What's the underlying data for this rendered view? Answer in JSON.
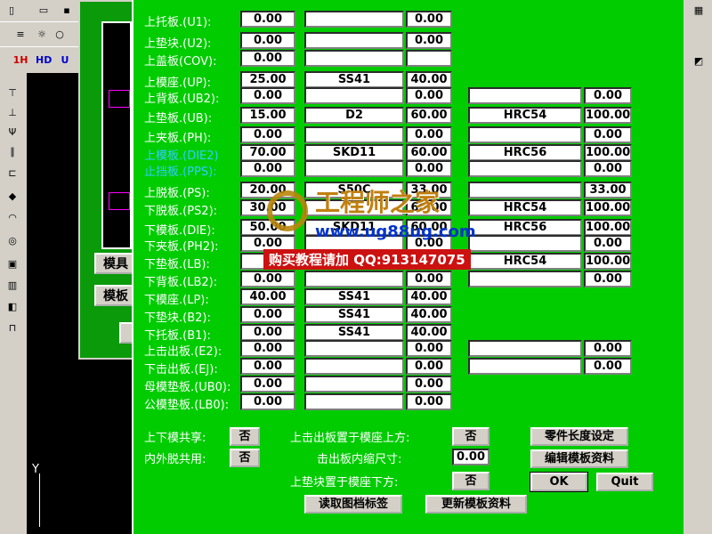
{
  "toolbar": {
    "row3_items": [
      "1H",
      "HD",
      "U"
    ]
  },
  "background_window": {
    "button_1": "模具",
    "button_2": "模板"
  },
  "rows": [
    {
      "label": "上托板.(U1):",
      "cyan": false,
      "a": "0.00",
      "b": "",
      "c": "0.00"
    },
    {
      "label": "上垫块.(U2):",
      "cyan": false,
      "a": "0.00",
      "b": "",
      "c": "0.00"
    },
    {
      "label": "上盖板(COV):",
      "cyan": false,
      "a": "0.00",
      "b": "",
      "c": ""
    },
    {
      "label": "上模座.(UP):",
      "cyan": false,
      "a": "25.00",
      "b": "SS41",
      "c": "40.00"
    },
    {
      "label": "上背板.(UB2):",
      "cyan": false,
      "a": "0.00",
      "b": "",
      "c": "0.00",
      "d": "",
      "e": "0.00"
    },
    {
      "label": "上垫板.(UB):",
      "cyan": false,
      "a": "15.00",
      "b": "D2",
      "c": "60.00",
      "d": "HRC54",
      "e": "100.00"
    },
    {
      "label": "上夹板.(PH):",
      "cyan": false,
      "a": "0.00",
      "b": "",
      "c": "0.00",
      "d": "",
      "e": "0.00"
    },
    {
      "label": "上模板.(DIE2)",
      "cyan": true,
      "a": "70.00",
      "b": "SKD11",
      "c": "60.00",
      "d": "HRC56",
      "e": "100.00"
    },
    {
      "label": "止挡板.(PPS):",
      "cyan": true,
      "a": "0.00",
      "b": "",
      "c": "0.00",
      "d": "",
      "e": "0.00"
    },
    {
      "label": "上脱板.(PS):",
      "cyan": false,
      "a": "20.00",
      "b": "S50C",
      "c": "33.00",
      "d": "",
      "e": "33.00"
    },
    {
      "label": "下脱板.(PS2):",
      "cyan": false,
      "a": "30.00",
      "b": "",
      "c": "60.00",
      "d": "HRC54",
      "e": "100.00"
    },
    {
      "label": "下模板.(DIE):",
      "cyan": false,
      "a": "50.00",
      "b": "SKD11",
      "c": "60.00",
      "d": "HRC56",
      "e": "100.00"
    },
    {
      "label": "下夹板.(PH2):",
      "cyan": false,
      "a": "0.00",
      "b": "",
      "c": "0.00",
      "d": "",
      "e": "0.00"
    },
    {
      "label": "下垫板.(LB):",
      "cyan": false,
      "a": "",
      "b": "",
      "c": "",
      "d": "HRC54",
      "e": "100.00"
    },
    {
      "label": "下背板.(LB2):",
      "cyan": false,
      "a": "0.00",
      "b": "",
      "c": "0.00",
      "d": "",
      "e": "0.00"
    },
    {
      "label": "下模座.(LP):",
      "cyan": false,
      "a": "40.00",
      "b": "SS41",
      "c": "40.00"
    },
    {
      "label": "下垫块.(B2):",
      "cyan": false,
      "a": "0.00",
      "b": "SS41",
      "c": "40.00"
    },
    {
      "label": "下托板.(B1):",
      "cyan": false,
      "a": "0.00",
      "b": "SS41",
      "c": "40.00"
    },
    {
      "label": "上击出板.(E2):",
      "cyan": false,
      "a": "0.00",
      "b": "",
      "c": "0.00",
      "d": "",
      "e": "0.00"
    },
    {
      "label": "下击出板.(EJ):",
      "cyan": false,
      "a": "0.00",
      "b": "",
      "c": "0.00",
      "d": "",
      "e": "0.00"
    },
    {
      "label": "母模垫板.(UB0):",
      "cyan": false,
      "a": "0.00",
      "b": "",
      "c": "0.00"
    },
    {
      "label": "公模垫板.(LB0):",
      "cyan": false,
      "a": "0.00",
      "b": "",
      "c": "0.00"
    }
  ],
  "bottom": {
    "shared_label": "上下模共享:",
    "shared_value": "否",
    "inner_label": "内外脱共用:",
    "inner_value": "否",
    "upper_eject_label": "上击出板置于模座上方:",
    "upper_eject_value": "否",
    "eject_shrink_label": "击出板内缩尺寸:",
    "eject_shrink_value": "0.00",
    "upper_pad_label": "上垫块置于模座下方:",
    "upper_pad_value": "否",
    "part_length_button": "零件长度设定",
    "edit_plate_button": "编辑模板资料",
    "ok_button": "OK",
    "quit_button": "Quit",
    "read_title_button": "读取图档标签",
    "update_plate_button": "更新模板资料"
  },
  "watermark": {
    "title": "工程师之家",
    "url": "www.ug88ug.com",
    "qq": "购买教程请加 QQ:913147075"
  },
  "axis_label": "Y"
}
